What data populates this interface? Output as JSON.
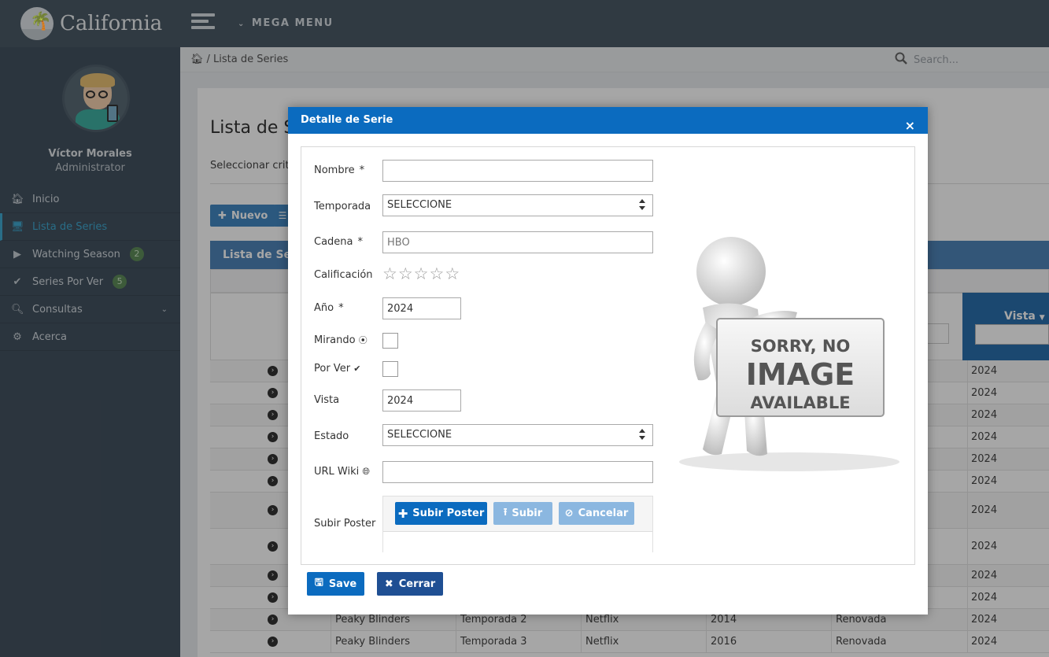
{
  "brand": {
    "name": "California"
  },
  "topbar": {
    "mega_menu": "MEGA MENU"
  },
  "user": {
    "name": "Víctor Morales",
    "role": "Administrator"
  },
  "sidebar": {
    "items": [
      {
        "label": "Inicio",
        "icon": "home-icon"
      },
      {
        "label": "Lista de Series",
        "icon": "desktop-icon",
        "active": true
      },
      {
        "label": "Watching Season",
        "icon": "play-circle-icon",
        "badge": "2"
      },
      {
        "label": "Series Por Ver",
        "icon": "check-circle-icon",
        "badge": "5"
      },
      {
        "label": "Consultas",
        "icon": "search-icon",
        "has_children": true
      },
      {
        "label": "Acerca",
        "icon": "gear-icon"
      }
    ]
  },
  "breadcrumb": {
    "separator": "/",
    "current": "Lista de Series"
  },
  "search": {
    "placeholder": "Search..."
  },
  "page": {
    "title": "Lista de Ser",
    "criteria": "Seleccionar criter",
    "new_button": "Nuevo",
    "table_title": "Lista de Ser",
    "vista_header": "Vista"
  },
  "table": {
    "rows": [
      {
        "serie": "",
        "temporada": "",
        "cadena": "",
        "anio": "",
        "estado": "",
        "vista": "2024"
      },
      {
        "serie": "",
        "temporada": "",
        "cadena": "",
        "anio": "",
        "estado": "",
        "vista": "2024"
      },
      {
        "serie": "",
        "temporada": "",
        "cadena": "",
        "anio": "",
        "estado": "",
        "vista": "2024"
      },
      {
        "serie": "",
        "temporada": "",
        "cadena": "",
        "anio": "",
        "estado": "",
        "vista": "2024"
      },
      {
        "serie": "",
        "temporada": "",
        "cadena": "",
        "anio": "",
        "estado": "",
        "vista": "2024"
      },
      {
        "serie": "",
        "temporada": "",
        "cadena": "",
        "anio": "",
        "estado": "",
        "vista": "2024"
      },
      {
        "serie": "",
        "temporada": "",
        "cadena": "",
        "anio": "",
        "estado": "",
        "vista": "2024"
      },
      {
        "serie": "",
        "temporada": "",
        "cadena": "",
        "anio": "",
        "estado": "",
        "vista": "2024"
      },
      {
        "serie": "",
        "temporada": "",
        "cadena": "",
        "anio": "",
        "estado": "",
        "vista": "2024"
      },
      {
        "serie": "",
        "temporada": "",
        "cadena": "",
        "anio": "",
        "estado": "",
        "vista": "2024"
      },
      {
        "serie": "Peaky Blinders",
        "temporada": "Temporada 2",
        "cadena": "Netflix",
        "anio": "2014",
        "estado": "Renovada",
        "vista": "2024"
      },
      {
        "serie": "Peaky Blinders",
        "temporada": "Temporada 3",
        "cadena": "Netflix",
        "anio": "2016",
        "estado": "Renovada",
        "vista": "2024"
      }
    ]
  },
  "modal": {
    "title": "Detalle de Serie",
    "close_glyph": "×",
    "fields": {
      "nombre_label": "Nombre",
      "nombre_value": "",
      "required_mark": "*",
      "temporada_label": "Temporada",
      "temporada_value": "SELECCIONE",
      "cadena_label": "Cadena",
      "cadena_placeholder": "HBO",
      "calificacion_label": "Calificación",
      "rating": 0,
      "rating_max": 5,
      "anio_label": "Año",
      "anio_value": "2024",
      "mirando_label": "Mirando",
      "mirando_checked": false,
      "porver_label": "Por Ver",
      "porver_checked": false,
      "vista_label": "Vista",
      "vista_value": "2024",
      "estado_label": "Estado",
      "estado_value": "SELECCIONE",
      "urlwiki_label": "URL Wiki",
      "urlwiki_value": "",
      "subirposter_label": "Subir Poster"
    },
    "upload": {
      "choose_label": "Subir Poster",
      "upload_label": "Subir",
      "cancel_label": "Cancelar"
    },
    "placeholder_image": {
      "line1": "SORRY, NO",
      "line2": "IMAGE",
      "line3": "AVAILABLE"
    },
    "save_label": "Save",
    "close_label": "Cerrar"
  },
  "colors": {
    "topbar": "#4a5966",
    "sidebar": "#435260",
    "accent": "#3fa8cf",
    "modal_header": "#0b6bbf",
    "close_button": "#1f4f93"
  }
}
